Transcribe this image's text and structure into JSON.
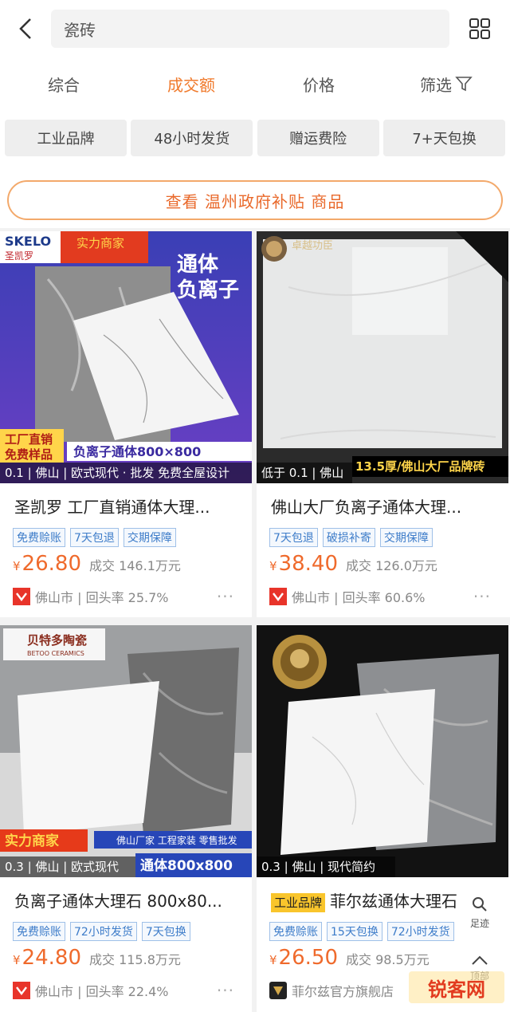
{
  "search": {
    "query": "瓷砖"
  },
  "sort_tabs": [
    {
      "label": "综合"
    },
    {
      "label": "成交额"
    },
    {
      "label": "价格"
    },
    {
      "label": "筛选"
    }
  ],
  "filter_chips": [
    "工业品牌",
    "48小时发货",
    "赠运费险",
    "7+天包换"
  ],
  "promo": {
    "text": "查看 温州政府补贴 商品"
  },
  "products": [
    {
      "image_meta": "0.1 | 佛山 | 欧式现代 · 批发 免费全屋设计",
      "image_texts": [
        "SKELO",
        "圣凯罗",
        "实力商家",
        "通体",
        "负离子",
        "工厂直销",
        "免费样品",
        "负离子通体800×800"
      ],
      "title": "圣凯罗 工厂直销通体大理...",
      "tags": [
        "免费赊账",
        "7天包退",
        "交期保障"
      ],
      "currency": "¥",
      "price": "26.80",
      "sales": "成交 146.1万元",
      "store_text": "佛山市 | 回头率 25.7%",
      "more": "···"
    },
    {
      "image_meta": "低于 0.1 | 佛山",
      "image_texts": [
        "卓越功臣",
        "13.5厚/佛山大厂品牌砖"
      ],
      "title": "佛山大厂负离子通体大理...",
      "tags": [
        "7天包退",
        "破损补寄",
        "交期保障"
      ],
      "currency": "¥",
      "price": "38.40",
      "sales": "成交 126.0万元",
      "store_text": "佛山市 | 回头率 60.6%",
      "more": "···"
    },
    {
      "image_meta": "0.3 | 佛山 | 欧式现代",
      "image_texts": [
        "贝特多陶瓷",
        "BETOO CERAMICS",
        "实力商家",
        "佛山厂家 工程家装 零售批发",
        "通体800x800"
      ],
      "title": "负离子通体大理石 800x80...",
      "tags": [
        "免费赊账",
        "72小时发货",
        "7天包换"
      ],
      "currency": "¥",
      "price": "24.80",
      "sales": "成交 115.8万元",
      "store_text": "佛山市 | 回头率 22.4%",
      "more": "···"
    },
    {
      "image_meta": "0.3 | 佛山 | 现代简约",
      "image_texts": [],
      "title_badge": "工业品牌",
      "title": "菲尔兹通体大理石",
      "tags": [
        "免费赊账",
        "15天包换",
        "72小时发货"
      ],
      "currency": "¥",
      "price": "26.50",
      "sales": "成交 98.5万元",
      "store_text": "菲尔兹官方旗舰店",
      "more": ""
    }
  ],
  "floating": {
    "footprint": "足迹",
    "top": "顶部"
  },
  "watermark": "锐客网",
  "colors": {
    "accent": "#f07a2c",
    "tag_blue": "#3d7cc9",
    "promo_border": "#f3a96b"
  }
}
